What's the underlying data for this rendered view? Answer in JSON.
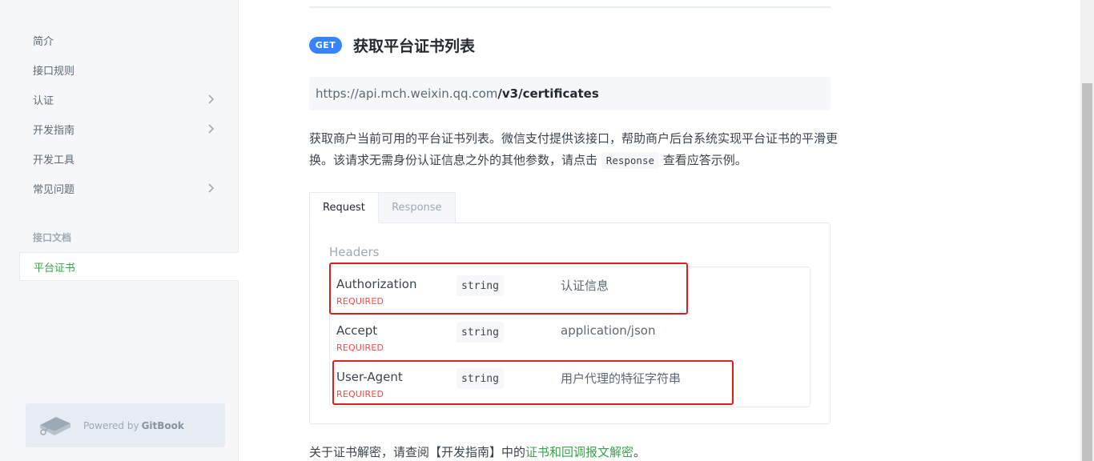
{
  "sidebar": {
    "items": [
      {
        "label": "简介",
        "has_children": false
      },
      {
        "label": "接口规则",
        "has_children": false
      },
      {
        "label": "认证",
        "has_children": true
      },
      {
        "label": "开发指南",
        "has_children": true
      },
      {
        "label": "开发工具",
        "has_children": false
      },
      {
        "label": "常见问题",
        "has_children": true
      }
    ],
    "section_title": "接口文档",
    "active_item": "平台证书",
    "powered_prefix": "Powered by",
    "powered_brand": "GitBook"
  },
  "endpoint": {
    "method": "GET",
    "title": "获取平台证书列表",
    "url_base": "https://api.mch.weixin.qq.com",
    "url_path": "/v3/certificates"
  },
  "description": {
    "text_before": "获取商户当前可用的平台证书列表。微信支付提供该接口，帮助商户后台系统实现平台证书的平滑更换。该请求无需身份认证信息之外的其他参数，请点击",
    "code": "Response",
    "text_after": "查看应答示例。"
  },
  "tabs": {
    "request": "Request",
    "response": "Response"
  },
  "headers": {
    "label": "Headers",
    "rows": [
      {
        "name": "Authorization",
        "required": "REQUIRED",
        "type": "string",
        "description": "认证信息"
      },
      {
        "name": "Accept",
        "required": "REQUIRED",
        "type": "string",
        "description": "application/json"
      },
      {
        "name": "User-Agent",
        "required": "REQUIRED",
        "type": "string",
        "description": "用户代理的特征字符串"
      }
    ]
  },
  "footer": {
    "text_before": "关于证书解密，请查阅【开发指南】中的",
    "link": "证书和回调报文解密",
    "text_after": "。"
  },
  "colors": {
    "accent": "#3884ff",
    "active_nav": "#3ba34d",
    "required": "#ff4642",
    "highlight_box": "#e02020"
  }
}
